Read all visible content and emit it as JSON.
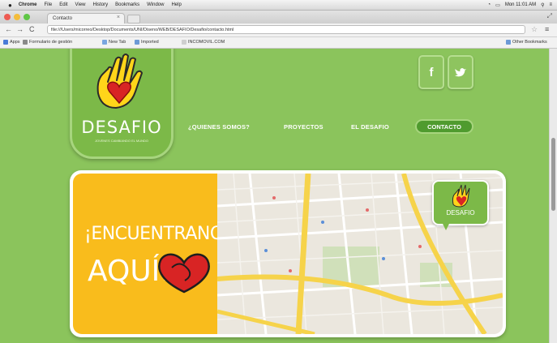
{
  "menubar": {
    "app": "Chrome",
    "items": [
      "File",
      "Edit",
      "View",
      "History",
      "Bookmarks",
      "Window",
      "Help"
    ],
    "clock": "Mon 11:01 AM"
  },
  "tab": {
    "title": "Contacto",
    "close": "×"
  },
  "toolbar": {
    "back": "←",
    "forward": "→",
    "reload": "C",
    "url": "file:///Users/micorreo/Desktop/Documents/UNI/Diseno/WEB/DESAFIO/Desafio/contacto.html",
    "star": "☆",
    "menu": "≡"
  },
  "bookmarks": {
    "items": [
      "Apps",
      "Formulario de gestión",
      "New Tab",
      "Imported",
      "INCOMOVIL.COM"
    ],
    "other": "Other Bookmarks"
  },
  "site": {
    "logo_text": "DESAFIO",
    "logo_sub": "JOVENES CAMBIANDO EL MUNDO",
    "social": {
      "facebook": "f",
      "twitter": "t"
    },
    "nav": {
      "quienes": "¿QUIENES SOMOS?",
      "proyectos": "PROYECTOS",
      "desafio": "EL DESAFIO",
      "contacto": "CONTACTO"
    },
    "hero": {
      "line1": "¡ENCUENTRANOS",
      "line2": "AQUÍ!"
    },
    "map_bubble": "DESAFIO"
  },
  "colors": {
    "page_bg": "#8bc45c",
    "brand_green": "#7cb948",
    "accent_yellow": "#f9bc1c",
    "heart_red": "#d82424",
    "active_nav": "#4f9b2e"
  }
}
